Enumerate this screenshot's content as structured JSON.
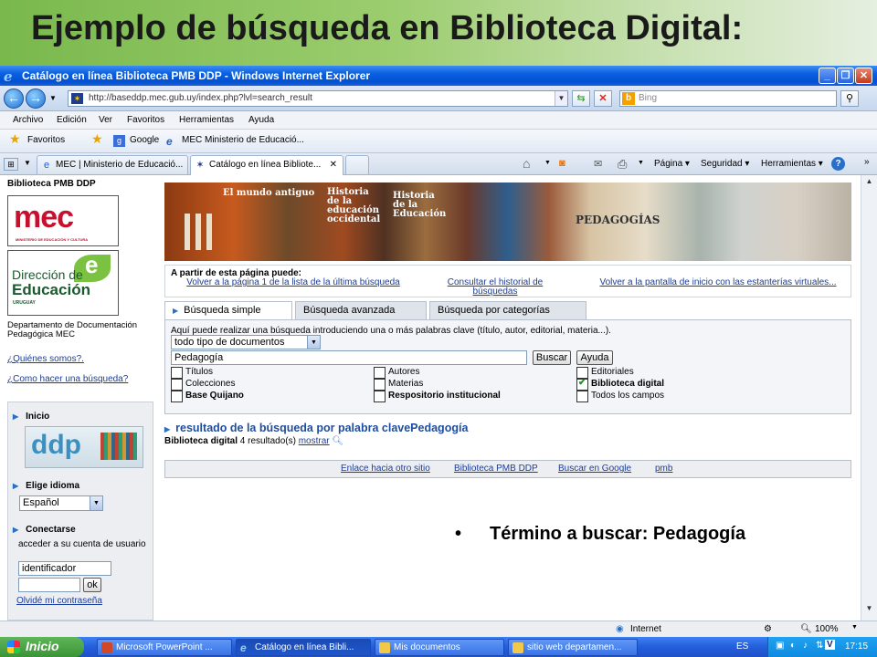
{
  "slide": {
    "title": "Ejemplo de búsqueda en Biblioteca Digital:",
    "bullet": "Término a buscar: Pedagogía"
  },
  "window": {
    "title": "Catálogo en línea Biblioteca PMB DDP - Windows Internet Explorer",
    "url": "http://baseddp.mec.gub.uy/index.php?lvl=search_result",
    "search_placeholder": "Bing",
    "menu": [
      "Archivo",
      "Edición",
      "Ver",
      "Favoritos",
      "Herramientas",
      "Ayuda"
    ],
    "favorites": {
      "label": "Favoritos",
      "items": [
        "Google",
        "MEC  Ministerio de Educació..."
      ]
    },
    "tabs": [
      "MEC | Ministerio de Educació...",
      "Catálogo en línea Bibliote..."
    ],
    "commands": [
      "Página",
      "Seguridad",
      "Herramientas"
    ]
  },
  "sidebar": {
    "site_title": "Biblioteca PMB DDP",
    "mec_logo": "mec",
    "mec_sub": "MINISTERIO DE EDUCACIÓN Y CULTURA",
    "dir_line1": "Dirección de",
    "dir_line2": "Educación",
    "dir_line3": "URUGUAY",
    "dept": "Departamento de Documentación Pedagógica MEC",
    "links": [
      "¿Quiénes somos?.",
      "¿Como hacer una búsqueda?"
    ],
    "inicio": "Inicio",
    "ddp_logo": "ddp",
    "idioma_title": "Elige idioma",
    "idioma_value": "Español",
    "conectarse_title": "Conectarse",
    "conectarse_text": "acceder a su cuenta de usuario",
    "user_value": "identificador",
    "ok": "ok",
    "forgot": "Olvidé mi contraseña"
  },
  "main": {
    "banner_texts": [
      "El mundo antiguo",
      "Historia de la educación occidental",
      "Historia de la Educación",
      "PEDAGOGÍAS"
    ],
    "info_title": "A partir de esta página puede:",
    "info_links": [
      "Volver a la página 1 de la lista de la última búsqueda",
      "Consultar el historial de búsquedas",
      "Volver a la pantalla de inicio con las estanterías virtuales..."
    ],
    "search_tabs": [
      "Búsqueda simple",
      "Búsqueda avanzada",
      "Búsqueda por categorías"
    ],
    "intro": "Aquí puede realizar una búsqueda introduciendo una o más palabras clave (título, autor, editorial, materia...).",
    "doc_type": "todo tipo de documentos",
    "query": "Pedagogía",
    "buscar": "Buscar",
    "ayuda": "Ayuda",
    "checkboxes": [
      {
        "label": "Títulos",
        "checked": false
      },
      {
        "label": "Autores",
        "checked": false
      },
      {
        "label": "Editoriales",
        "checked": false
      },
      {
        "label": "Colecciones",
        "checked": false
      },
      {
        "label": "Materias",
        "checked": false
      },
      {
        "label": "Biblioteca digital",
        "checked": true
      },
      {
        "label": "Base Quijano",
        "checked": false
      },
      {
        "label": "Respositorio institucional",
        "checked": false
      },
      {
        "label": "Todos los campos",
        "checked": false
      }
    ],
    "result_title": "resultado de la búsqueda por palabra clavePedagogía",
    "result_source": "Biblioteca digital",
    "result_count": "4 resultado(s)",
    "result_show": "mostrar",
    "footer_links": [
      "Enlace hacia otro sitio",
      "Biblioteca PMB DDP",
      "Buscar en Google",
      "pmb"
    ]
  },
  "status": {
    "zone": "Internet",
    "zoom": "100%"
  },
  "taskbar": {
    "start": "Inicio",
    "items": [
      "Microsoft PowerPoint ...",
      "Catálogo en línea Bibli...",
      "Mis documentos",
      "sitio web departamen..."
    ],
    "lang": "ES",
    "clock": "17:15"
  }
}
